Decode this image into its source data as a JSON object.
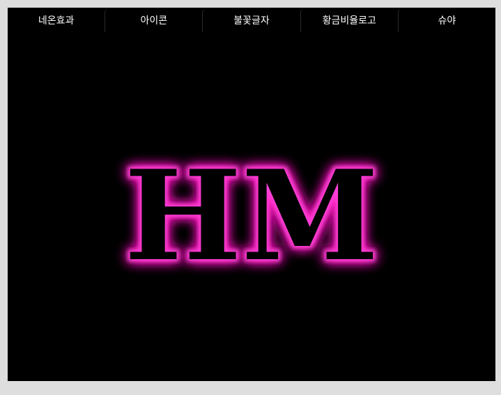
{
  "tabs": [
    {
      "label": "네온효과"
    },
    {
      "label": "아이콘"
    },
    {
      "label": "불꽃글자"
    },
    {
      "label": "황금비율로고"
    },
    {
      "label": "슈야"
    }
  ],
  "stage": {
    "logo_text": "HM",
    "glow_color": "#ff1dc2",
    "glow_color_inner": "#ff3fd6",
    "text_color": "#000000",
    "background": "#000000"
  }
}
